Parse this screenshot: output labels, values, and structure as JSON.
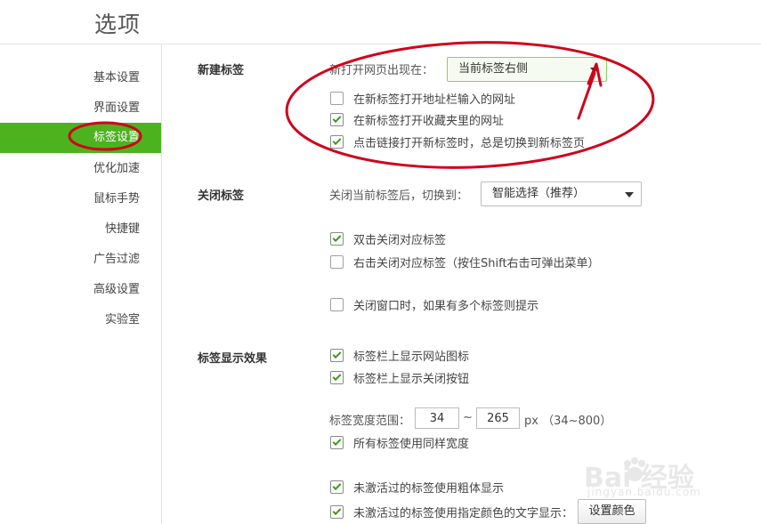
{
  "header": {
    "title": "选项"
  },
  "sidebar": {
    "items": [
      {
        "label": "基本设置",
        "active": false
      },
      {
        "label": "界面设置",
        "active": false
      },
      {
        "label": "标签设置",
        "active": true
      },
      {
        "label": "优化加速",
        "active": false
      },
      {
        "label": "鼠标手势",
        "active": false
      },
      {
        "label": "快捷键",
        "active": false
      },
      {
        "label": "广告过滤",
        "active": false
      },
      {
        "label": "高级设置",
        "active": false
      },
      {
        "label": "实验室",
        "active": false
      }
    ]
  },
  "new_tab": {
    "title": "新建标签",
    "open_position_label": "新打开网页出现在：",
    "open_position_value": "当前标签右侧",
    "options": [
      {
        "label": "在新标签打开地址栏输入的网址",
        "checked": false
      },
      {
        "label": "在新标签打开收藏夹里的网址",
        "checked": true
      },
      {
        "label": "点击链接打开新标签时，总是切换到新标签页",
        "checked": true
      }
    ]
  },
  "close_tab": {
    "title": "关闭标签",
    "after_close_label": "关闭当前标签后，切换到：",
    "after_close_value": "智能选择（推荐）",
    "options": [
      {
        "label": "双击关闭对应标签",
        "checked": true
      },
      {
        "label": "右击关闭对应标签（按住Shift右击可弹出菜单）",
        "checked": false
      },
      {
        "label": "关闭窗口时，如果有多个标签则提示",
        "checked": false
      }
    ]
  },
  "tab_display": {
    "title": "标签显示效果",
    "options_top": [
      {
        "label": "标签栏上显示网站图标",
        "checked": true
      },
      {
        "label": "标签栏上显示关闭按钮",
        "checked": true
      }
    ],
    "width_range_label": "标签宽度范围：",
    "width_min": "34",
    "width_sep": "~",
    "width_max": "265",
    "width_unit": "px （34~800）",
    "options_bottom": [
      {
        "label": "所有标签使用同样宽度",
        "checked": true
      },
      {
        "label": "未激活过的标签使用粗体显示",
        "checked": true
      },
      {
        "label": "未激活过的标签使用指定颜色的文字显示：",
        "checked": true
      }
    ],
    "set_color_button": "设置颜色"
  },
  "watermark": {
    "brand": "Bai  经验",
    "url": "jingyan.baidu.com"
  },
  "colors": {
    "accent": "#4cb21e",
    "annotation": "#d0021b"
  }
}
